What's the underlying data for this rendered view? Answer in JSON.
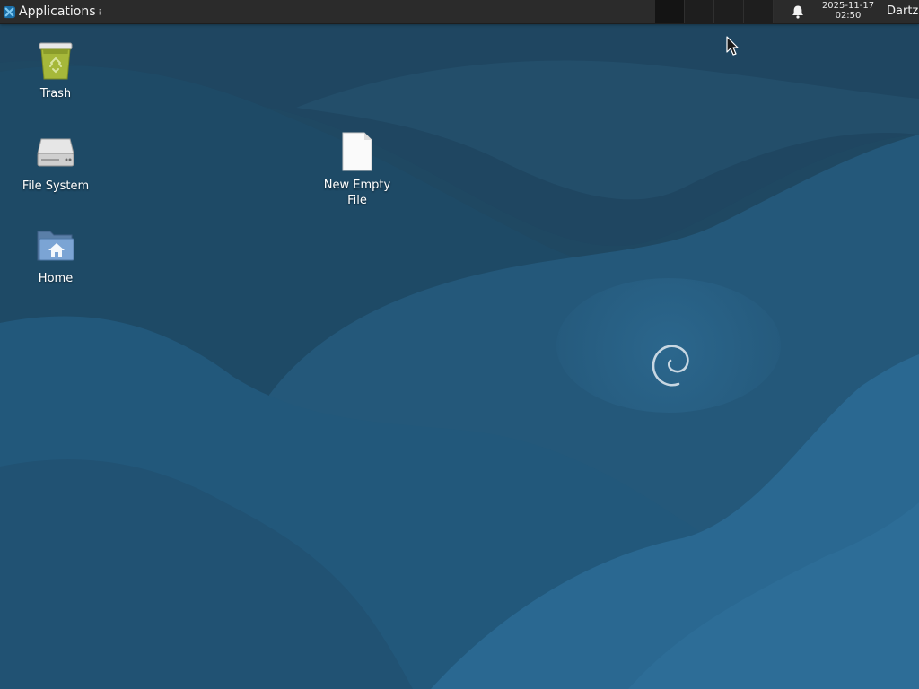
{
  "panel": {
    "applications_label": "Applications",
    "applications_handle": "⁝",
    "workspace_count": 4,
    "clock": {
      "date": "2025-11-17",
      "time": "02:50"
    },
    "user_name": "Dartz",
    "icons": {
      "logo": "xfce-logo-icon",
      "notifications": "bell-icon"
    }
  },
  "desktop": {
    "icons": [
      {
        "label": "Trash",
        "icon": "trash-icon"
      },
      {
        "label": "File System",
        "icon": "drive-icon"
      },
      {
        "label": "Home",
        "icon": "home-folder-icon"
      },
      {
        "label": "New Empty File",
        "icon": "empty-file-icon"
      }
    ]
  },
  "colors": {
    "panel_bg": "#2b2b2b",
    "wallpaper_base": "#1d4560",
    "wallpaper_light": "#2a6a94"
  }
}
